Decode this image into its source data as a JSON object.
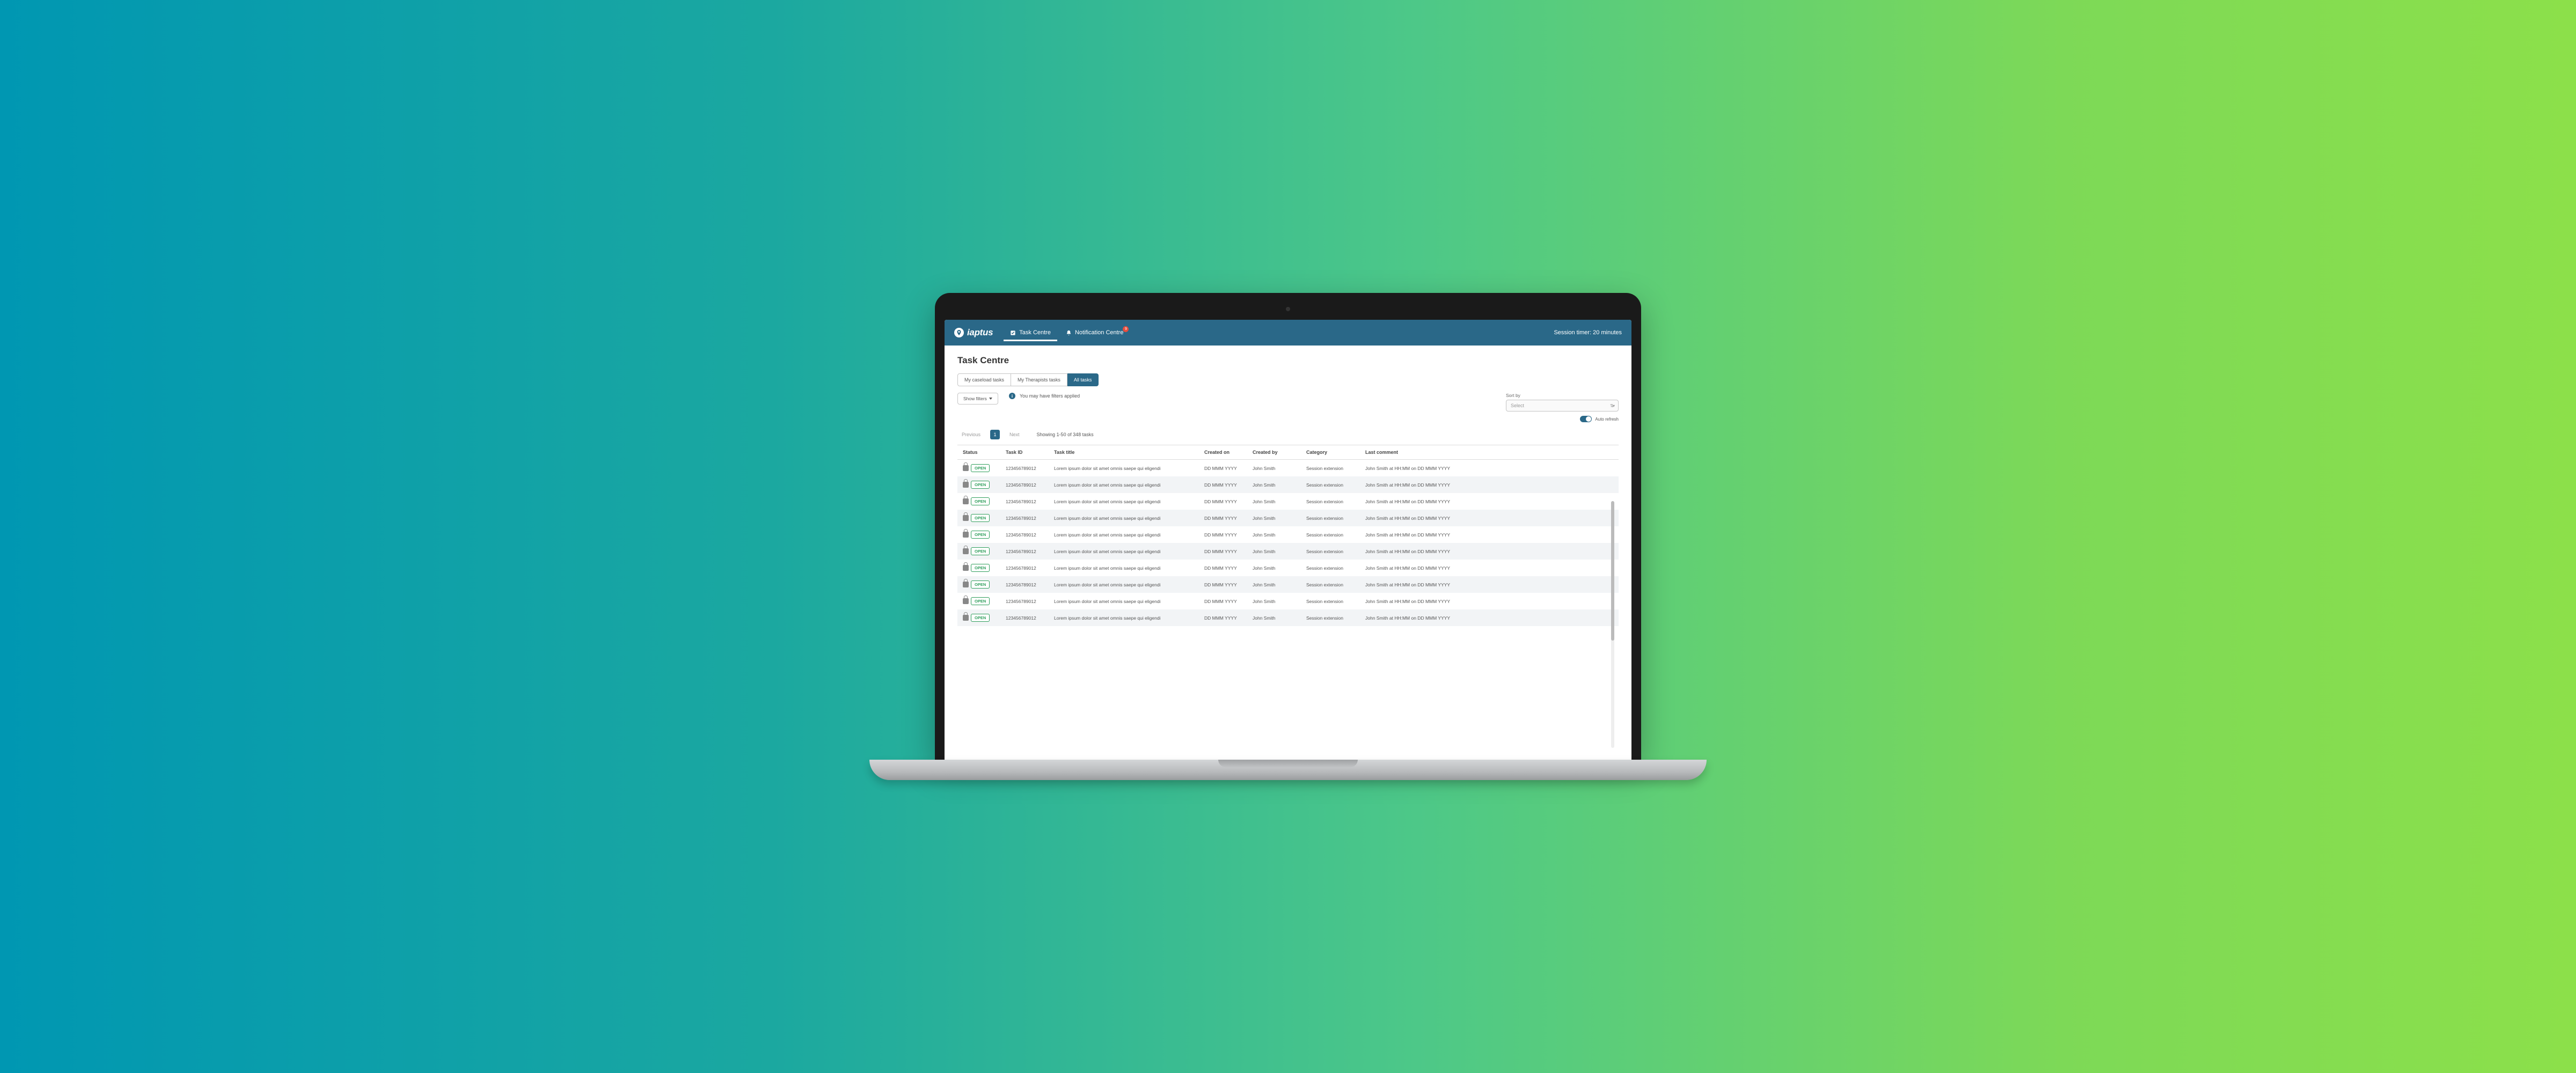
{
  "header": {
    "logo_text": "iaptus",
    "nav": [
      {
        "label": "Task Centre",
        "icon": "task-icon",
        "active": true
      },
      {
        "label": "Notification Centre",
        "icon": "bell-icon",
        "badge": "9"
      }
    ],
    "session_timer": "Session timer: 20 minutes"
  },
  "page": {
    "title": "Task Centre",
    "tabs": [
      {
        "label": "My caseload tasks",
        "active": false
      },
      {
        "label": "My Therapists tasks",
        "active": false
      },
      {
        "label": "All tasks",
        "active": true
      }
    ],
    "show_filters": "Show filters",
    "filter_info": "You may have filters applied",
    "sort": {
      "label": "Sort by",
      "placeholder": "Select"
    },
    "toggle_label": "Auto refresh",
    "pagination": {
      "previous": "Previous",
      "page": "1",
      "next": "Next",
      "showing": "Showing 1-50 of 348 tasks"
    },
    "columns": [
      "Status",
      "Task ID",
      "Task title",
      "Created on",
      "Created by",
      "Category",
      "Last comment"
    ],
    "rows": [
      {
        "status": "OPEN",
        "id": "123456789012",
        "title": "Lorem ipsum dolor sit amet omnis saepe qui eligendi",
        "created_on": "DD MMM YYYY",
        "created_by": "John Smith",
        "category": "Session extension",
        "last_comment": "John Smith at HH:MM on DD MMM YYYY"
      },
      {
        "status": "OPEN",
        "id": "123456789012",
        "title": "Lorem ipsum dolor sit amet omnis saepe qui eligendi",
        "created_on": "DD MMM YYYY",
        "created_by": "John Smith",
        "category": "Session extension",
        "last_comment": "John Smith at HH:MM on DD MMM YYYY"
      },
      {
        "status": "OPEN",
        "id": "123456789012",
        "title": "Lorem ipsum dolor sit amet omnis saepe qui eligendi",
        "created_on": "DD MMM YYYY",
        "created_by": "John Smith",
        "category": "Session extension",
        "last_comment": "John Smith at HH:MM on DD MMM YYYY"
      },
      {
        "status": "OPEN",
        "id": "123456789012",
        "title": "Lorem ipsum dolor sit amet omnis saepe qui eligendi",
        "created_on": "DD MMM YYYY",
        "created_by": "John Smith",
        "category": "Session extension",
        "last_comment": "John Smith at HH:MM on DD MMM YYYY"
      },
      {
        "status": "OPEN",
        "id": "123456789012",
        "title": "Lorem ipsum dolor sit amet omnis saepe qui eligendi",
        "created_on": "DD MMM YYYY",
        "created_by": "John Smith",
        "category": "Session extension",
        "last_comment": "John Smith at HH:MM on DD MMM YYYY"
      },
      {
        "status": "OPEN",
        "id": "123456789012",
        "title": "Lorem ipsum dolor sit amet omnis saepe qui eligendi",
        "created_on": "DD MMM YYYY",
        "created_by": "John Smith",
        "category": "Session extension",
        "last_comment": "John Smith at HH:MM on DD MMM YYYY"
      },
      {
        "status": "OPEN",
        "id": "123456789012",
        "title": "Lorem ipsum dolor sit amet omnis saepe qui eligendi",
        "created_on": "DD MMM YYYY",
        "created_by": "John Smith",
        "category": "Session extension",
        "last_comment": "John Smith at HH:MM on DD MMM YYYY"
      },
      {
        "status": "OPEN",
        "id": "123456789012",
        "title": "Lorem ipsum dolor sit amet omnis saepe qui eligendi",
        "created_on": "DD MMM YYYY",
        "created_by": "John Smith",
        "category": "Session extension",
        "last_comment": "John Smith at HH:MM on DD MMM YYYY"
      },
      {
        "status": "OPEN",
        "id": "123456789012",
        "title": "Lorem ipsum dolor sit amet omnis saepe qui eligendi",
        "created_on": "DD MMM YYYY",
        "created_by": "John Smith",
        "category": "Session extension",
        "last_comment": "John Smith at HH:MM on DD MMM YYYY"
      },
      {
        "status": "OPEN",
        "id": "123456789012",
        "title": "Lorem ipsum dolor sit amet omnis saepe qui eligendi",
        "created_on": "DD MMM YYYY",
        "created_by": "John Smith",
        "category": "Session extension",
        "last_comment": "John Smith at HH:MM on DD MMM YYYY"
      }
    ]
  }
}
